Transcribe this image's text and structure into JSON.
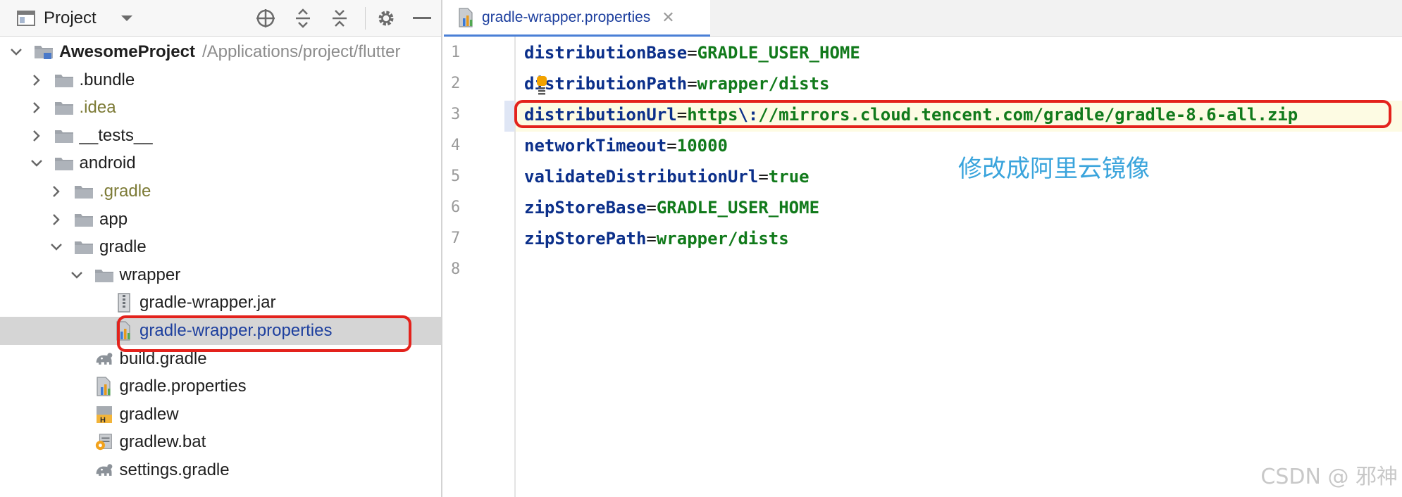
{
  "project_panel": {
    "toolbar": {
      "title": "Project",
      "icons": [
        "view-mode-icon",
        "chevron-down-icon",
        "locate-icon",
        "expand-all-icon",
        "collapse-all-icon",
        "gear-icon",
        "minimize-icon"
      ]
    },
    "tree": [
      {
        "name": "AwesomeProject",
        "hint": "/Applications/project/flutter",
        "depth": 0,
        "expanded": true,
        "icon": "module-folder-icon",
        "bold": true
      },
      {
        "name": ".bundle",
        "depth": 1,
        "expanded": false,
        "icon": "folder-icon"
      },
      {
        "name": ".idea",
        "depth": 1,
        "expanded": false,
        "icon": "folder-icon",
        "muted": true
      },
      {
        "name": "__tests__",
        "depth": 1,
        "expanded": false,
        "icon": "folder-icon"
      },
      {
        "name": "android",
        "depth": 1,
        "expanded": true,
        "icon": "folder-icon"
      },
      {
        "name": ".gradle",
        "depth": 2,
        "expanded": false,
        "icon": "folder-icon",
        "muted": true
      },
      {
        "name": "app",
        "depth": 2,
        "expanded": false,
        "icon": "folder-icon"
      },
      {
        "name": "gradle",
        "depth": 2,
        "expanded": true,
        "icon": "folder-icon"
      },
      {
        "name": "wrapper",
        "depth": 3,
        "expanded": true,
        "icon": "folder-icon"
      },
      {
        "name": "gradle-wrapper.jar",
        "depth": 4,
        "icon": "jar-file-icon"
      },
      {
        "name": "gradle-wrapper.properties",
        "depth": 4,
        "icon": "properties-file-icon",
        "selected": true
      },
      {
        "name": "build.gradle",
        "depth": 3,
        "icon": "gradle-elephant-icon"
      },
      {
        "name": "gradle.properties",
        "depth": 3,
        "icon": "properties-file-icon"
      },
      {
        "name": "gradlew",
        "depth": 3,
        "icon": "shell-script-icon"
      },
      {
        "name": "gradlew.bat",
        "depth": 3,
        "icon": "batch-file-icon"
      },
      {
        "name": "settings.gradle",
        "depth": 3,
        "icon": "gradle-elephant-icon"
      }
    ]
  },
  "editor": {
    "tab": {
      "label": "gradle-wrapper.properties",
      "close_symbol": "✕",
      "icon": "properties-file-icon"
    },
    "line_numbers": [
      "1",
      "2",
      "3",
      "4",
      "5",
      "6",
      "7",
      "8"
    ],
    "current_line": 3,
    "lines": [
      {
        "key": "distributionBase",
        "eq": "=",
        "value": "GRADLE_USER_HOME"
      },
      {
        "key": "distributionPath",
        "eq": "=",
        "value": "wrapper/dists"
      },
      {
        "key": "distributionUrl",
        "eq": "=",
        "value_prefix": "https",
        "escape": "\\:",
        "value": "//mirrors.cloud.tencent.com/gradle/gradle-8.6-all.zip"
      },
      {
        "key": "networkTimeout",
        "eq": "=",
        "value": "10000"
      },
      {
        "key": "validateDistributionUrl",
        "eq": "=",
        "value": "true"
      },
      {
        "key": "zipStoreBase",
        "eq": "=",
        "value": "GRADLE_USER_HOME"
      },
      {
        "key": "zipStorePath",
        "eq": "=",
        "value": "wrapper/dists"
      },
      {
        "key": "",
        "eq": "",
        "value": ""
      }
    ]
  },
  "annotation": {
    "note": "修改成阿里云镜像",
    "box_color": "#e3221c",
    "note_color": "#3aa4dc"
  },
  "watermark": "CSDN @ 邪神"
}
